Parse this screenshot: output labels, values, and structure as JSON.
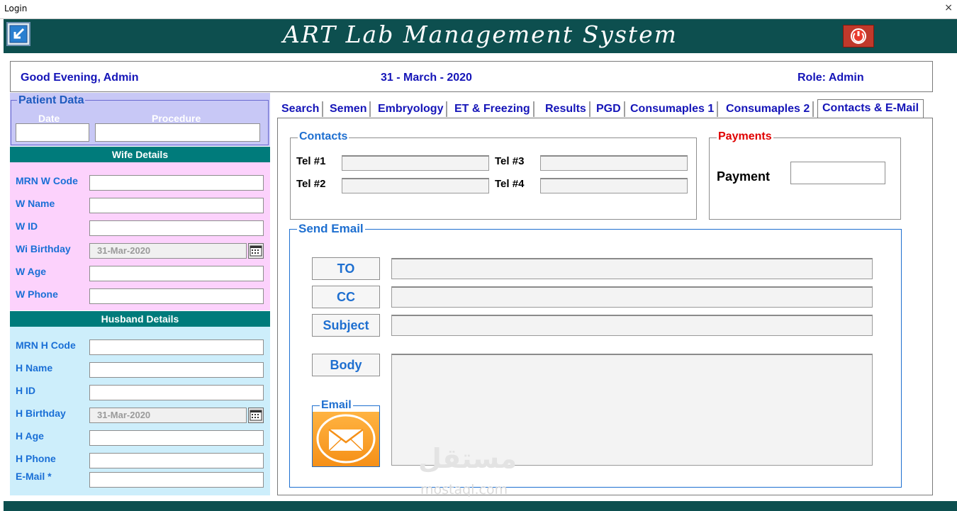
{
  "window": {
    "title": "Login",
    "close_glyph": "×"
  },
  "header": {
    "app_title": "ART Lab Management System",
    "back_icon": "back-arrow-icon",
    "power_icon": "power-icon"
  },
  "infobar": {
    "greeting": "Good Evening, Admin",
    "date": "31 - March - 2020",
    "role": "Role:  Admin"
  },
  "patient": {
    "legend": "Patient Data",
    "date_label": "Date",
    "procedure_label": "Procedure",
    "date_value": "",
    "procedure_value": ""
  },
  "wife": {
    "heading": "Wife Details",
    "fields": [
      {
        "label": "MRN W Code",
        "value": ""
      },
      {
        "label": "W Name",
        "value": ""
      },
      {
        "label": "W ID",
        "value": ""
      },
      {
        "label": "Wi Birthday",
        "value": "31-Mar-2020"
      },
      {
        "label": "W Age",
        "value": ""
      },
      {
        "label": "W Phone",
        "value": ""
      }
    ]
  },
  "husband": {
    "heading": "Husband Details",
    "fields": [
      {
        "label": "MRN H Code",
        "value": ""
      },
      {
        "label": "H Name",
        "value": ""
      },
      {
        "label": "H ID",
        "value": ""
      },
      {
        "label": "H Birthday",
        "value": "31-Mar-2020"
      },
      {
        "label": "H Age",
        "value": ""
      },
      {
        "label": "H Phone",
        "value": ""
      },
      {
        "label": "E-Mail *",
        "value": ""
      }
    ]
  },
  "tabs": [
    {
      "label": "Search"
    },
    {
      "label": "Semen"
    },
    {
      "label": "Embryology"
    },
    {
      "label": "ET & Freezing"
    },
    {
      "label": "Results"
    },
    {
      "label": "PGD"
    },
    {
      "label": "Consumaples 1"
    },
    {
      "label": "Consumaples 2"
    },
    {
      "label": "Contacts & E-Mail"
    }
  ],
  "contacts": {
    "legend": "Contacts",
    "tel1": "Tel #1",
    "tel2": "Tel #2",
    "tel3": "Tel #3",
    "tel4": "Tel #4"
  },
  "payments": {
    "legend": "Payments",
    "label": "Payment",
    "value": ""
  },
  "send_email": {
    "legend": "Send Email",
    "to": "TO",
    "cc": "CC",
    "subject": "Subject",
    "body": "Body",
    "email_legend": "Email"
  },
  "colors": {
    "header_bg": "#0d4f4f",
    "wife_bg": "#fcd2fc",
    "husband_bg": "#cdeefb",
    "teal_heading": "#007b7b",
    "accent_blue": "#1e6fd0",
    "payments_red": "#e00000"
  },
  "watermark": {
    "arabic": "مستقل",
    "latin": "mostaql.com"
  }
}
